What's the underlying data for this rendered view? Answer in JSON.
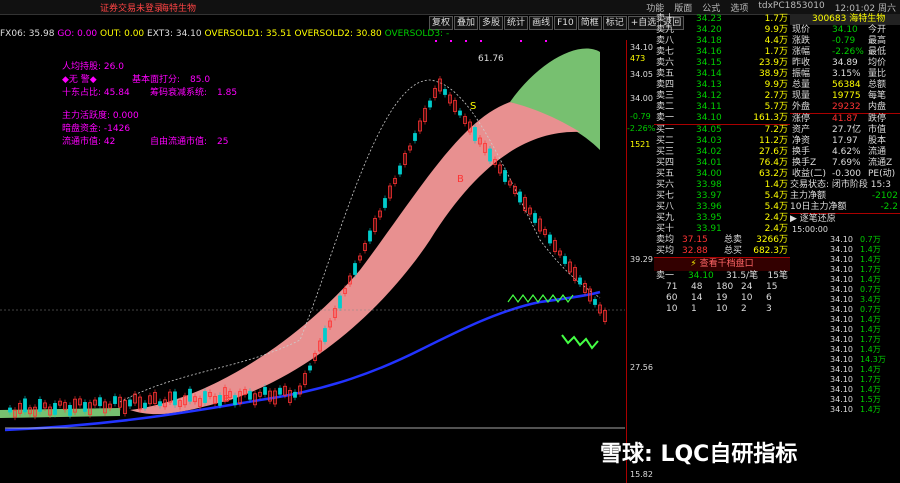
{
  "titlebar": {
    "warning": "证券交易未登录",
    "stock_name": "海特生物",
    "menu": [
      "功能",
      "版面",
      "公式",
      "选项",
      "tdxPC1853010",
      "12:01:02 周六"
    ]
  },
  "toolbar": {
    "buttons": [
      "复权",
      "叠加",
      "多股",
      "统计",
      "画线",
      "F10",
      "简框",
      "标记",
      "+自选",
      "返回"
    ]
  },
  "indicator_header": {
    "name": "FX06: 35.98",
    "go": "GO: 0.00",
    "out": "OUT: 0.00",
    "ext": "EXT3: 34.10",
    "os1": "OVERSOLD1: 35.51",
    "os2": "OVERSOLD2: 30.80",
    "os3": "OVERSOLD3: -"
  },
  "stats_panel": {
    "rows": [
      {
        "label": "人均持股:",
        "value": "26.0",
        "label2": "",
        "value2": ""
      },
      {
        "label": "◆无 警◆",
        "value": "",
        "label2": "基本面打分:",
        "value2": "85.0"
      },
      {
        "label": "十东占比:",
        "value": "45.84",
        "label2": "筹码衰减系统:",
        "value2": "1.85"
      },
      {
        "label": "主力活跃度:",
        "value": "0.000",
        "label2": "",
        "value2": ""
      },
      {
        "label": "暗盘资金:",
        "value": "-1426",
        "label2": "",
        "value2": ""
      },
      {
        "label": "流通市值:",
        "value": "42",
        "label2": "自由流通市值:",
        "value2": "25"
      }
    ]
  },
  "chart_labels": {
    "peak": "61.76",
    "signal_s": "S",
    "signal_b1": "B",
    "signal_b2": "B",
    "watermark": "雪球: LQC自研指标"
  },
  "y_axis": {
    "ticks": [
      "34.10",
      "473",
      "34.05",
      "34.00",
      "-0.79",
      "-2.26%",
      "1521",
      "39.29",
      "27.56",
      "15.82"
    ]
  },
  "order_book": {
    "sell": [
      {
        "label": "卖十",
        "price": "34.23",
        "vol": "1.7万"
      },
      {
        "label": "卖九",
        "price": "34.20",
        "vol": "9.9万"
      },
      {
        "label": "卖八",
        "price": "34.18",
        "vol": "4.4万"
      },
      {
        "label": "卖七",
        "price": "34.16",
        "vol": "1.7万"
      },
      {
        "label": "卖六",
        "price": "34.15",
        "vol": "23.9万"
      },
      {
        "label": "卖五",
        "price": "34.14",
        "vol": "38.9万"
      },
      {
        "label": "卖四",
        "price": "34.13",
        "vol": "9.9万"
      },
      {
        "label": "卖三",
        "price": "34.12",
        "vol": "2.7万"
      },
      {
        "label": "卖二",
        "price": "34.11",
        "vol": "5.7万"
      },
      {
        "label": "卖一",
        "price": "34.10",
        "vol": "161.3万"
      }
    ],
    "buy": [
      {
        "label": "买一",
        "price": "34.05",
        "vol": "7.2万"
      },
      {
        "label": "买二",
        "price": "34.03",
        "vol": "11.2万"
      },
      {
        "label": "买三",
        "price": "34.02",
        "vol": "27.6万"
      },
      {
        "label": "买四",
        "price": "34.01",
        "vol": "76.4万"
      },
      {
        "label": "买五",
        "price": "34.00",
        "vol": "63.2万"
      },
      {
        "label": "买六",
        "price": "33.98",
        "vol": "1.4万"
      },
      {
        "label": "买七",
        "price": "33.97",
        "vol": "5.4万"
      },
      {
        "label": "买八",
        "price": "33.96",
        "vol": "5.4万"
      },
      {
        "label": "买九",
        "price": "33.95",
        "vol": "2.4万"
      },
      {
        "label": "买十",
        "price": "33.91",
        "vol": "2.4万"
      }
    ],
    "avg_sell": {
      "label": "卖均",
      "price": "37.15",
      "tag": "总卖",
      "vol": "3266万"
    },
    "avg_buy": {
      "label": "买均",
      "price": "32.88",
      "tag": "总买",
      "vol": "682.3万"
    },
    "check_btn": "查看千档盘口",
    "level1": {
      "label": "卖一",
      "price": "34.10",
      "lot": "31.5/笔",
      "count": "15笔"
    },
    "queue": [
      [
        "71",
        "48",
        "180",
        "24",
        "15"
      ],
      [
        "60",
        "14",
        "19",
        "10",
        "6"
      ],
      [
        "10",
        "1",
        "10",
        "2",
        "3"
      ]
    ]
  },
  "quote": {
    "code": "300683",
    "name": "海特生物",
    "rows": [
      {
        "k1": "现价",
        "v1": "34.10",
        "k2": "今开",
        "v2": "",
        "c": "g"
      },
      {
        "k1": "涨跌",
        "v1": "-0.79",
        "k2": "最高",
        "v2": "",
        "c": "g"
      },
      {
        "k1": "涨幅",
        "v1": "-2.26%",
        "k2": "最低",
        "v2": "",
        "c": "g"
      },
      {
        "k1": "昨收",
        "v1": "34.89",
        "k2": "均价",
        "v2": "",
        "c": "w"
      },
      {
        "k1": "振幅",
        "v1": "3.15%",
        "k2": "量比",
        "v2": "",
        "c": "w"
      },
      {
        "k1": "总量",
        "v1": "56384",
        "k2": "总额",
        "v2": "",
        "c": "y"
      },
      {
        "k1": "现量",
        "v1": "19775",
        "k2": "每笔",
        "v2": "",
        "c": "y"
      },
      {
        "k1": "外盘",
        "v1": "29232",
        "k2": "内盘",
        "v2": "",
        "c": "r"
      },
      {
        "k1": "涨停",
        "v1": "41.87",
        "k2": "跌停",
        "v2": "",
        "c": "r"
      },
      {
        "k1": "资产",
        "v1": "27.7亿",
        "k2": "市值",
        "v2": "",
        "c": "w"
      },
      {
        "k1": "净资",
        "v1": "17.97",
        "k2": "股本",
        "v2": "",
        "c": "w"
      },
      {
        "k1": "换手",
        "v1": "4.62%",
        "k2": "流通",
        "v2": "",
        "c": "w"
      },
      {
        "k1": "换手Z",
        "v1": "7.69%",
        "k2": "流通Z",
        "v2": "",
        "c": "w"
      },
      {
        "k1": "收益(二)",
        "v1": "-0.300",
        "k2": "PE(动)",
        "v2": "",
        "c": "w"
      }
    ],
    "status": "交易状态: 闭市阶段 15:3",
    "main_net": {
      "label": "主力净额",
      "value": "-2102"
    },
    "main_net10": {
      "label": "10日主力净额",
      "value": "-2.2"
    },
    "ticks_title": "逐笔还原",
    "ticks": [
      {
        "t": "15:00:00",
        "p": "",
        "v": ""
      },
      {
        "t": "",
        "p": "34.10",
        "v": "0.7万"
      },
      {
        "t": "",
        "p": "34.10",
        "v": "1.4万"
      },
      {
        "t": "",
        "p": "34.10",
        "v": "1.4万"
      },
      {
        "t": "",
        "p": "34.10",
        "v": "1.7万"
      },
      {
        "t": "",
        "p": "34.10",
        "v": "1.4万"
      },
      {
        "t": "",
        "p": "34.10",
        "v": "0.7万"
      },
      {
        "t": "",
        "p": "34.10",
        "v": "3.4万"
      },
      {
        "t": "",
        "p": "34.10",
        "v": "0.7万"
      },
      {
        "t": "",
        "p": "34.10",
        "v": "1.4万"
      },
      {
        "t": "",
        "p": "34.10",
        "v": "1.4万"
      },
      {
        "t": "",
        "p": "34.10",
        "v": "1.7万"
      },
      {
        "t": "",
        "p": "34.10",
        "v": "1.4万"
      },
      {
        "t": "",
        "p": "34.10",
        "v": "14.3万"
      },
      {
        "t": "",
        "p": "34.10",
        "v": "1.4万"
      },
      {
        "t": "",
        "p": "34.10",
        "v": "1.7万"
      },
      {
        "t": "",
        "p": "34.10",
        "v": "1.4万"
      },
      {
        "t": "",
        "p": "34.10",
        "v": "1.5万"
      },
      {
        "t": "",
        "p": "34.10",
        "v": "1.4万"
      }
    ]
  },
  "colors": {
    "up": "#ff3333",
    "down": "#00cccc",
    "ma_blue": "#2233ff",
    "band_red": "#e89090",
    "band_green": "#77c070"
  }
}
